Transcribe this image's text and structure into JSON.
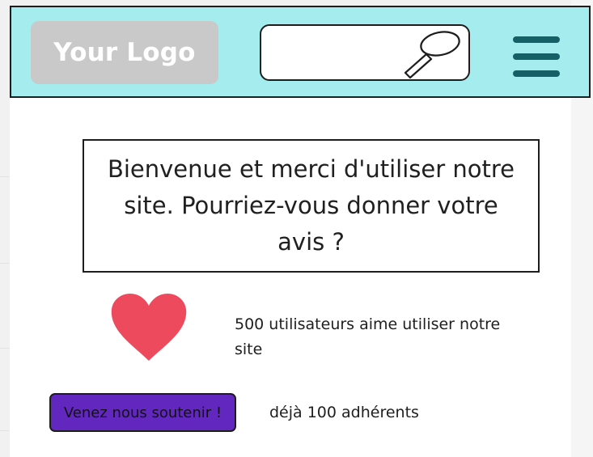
{
  "header": {
    "logo_text": "Your Logo",
    "search": {
      "placeholder": "",
      "value": "",
      "icon": "search-icon"
    },
    "menu_icon": "hamburger-menu-icon",
    "colors": {
      "header_bg": "#a5ecef",
      "logo_bg": "#c9c9c9",
      "logo_text": "#ffffff",
      "menu_bar": "#155f66"
    }
  },
  "main": {
    "welcome_text": "Bienvenue et merci d'utiliser notre site. Pourriez-vous donner votre avis ?",
    "users_text": "500 utilisateurs aime utiliser notre site",
    "support_button_label": "Venez nous soutenir !",
    "members_text": "déjà 100 adhérents",
    "heart_icon": "heart-icon",
    "colors": {
      "heart": "#ee4a5e",
      "button_bg": "#6227bf"
    }
  }
}
